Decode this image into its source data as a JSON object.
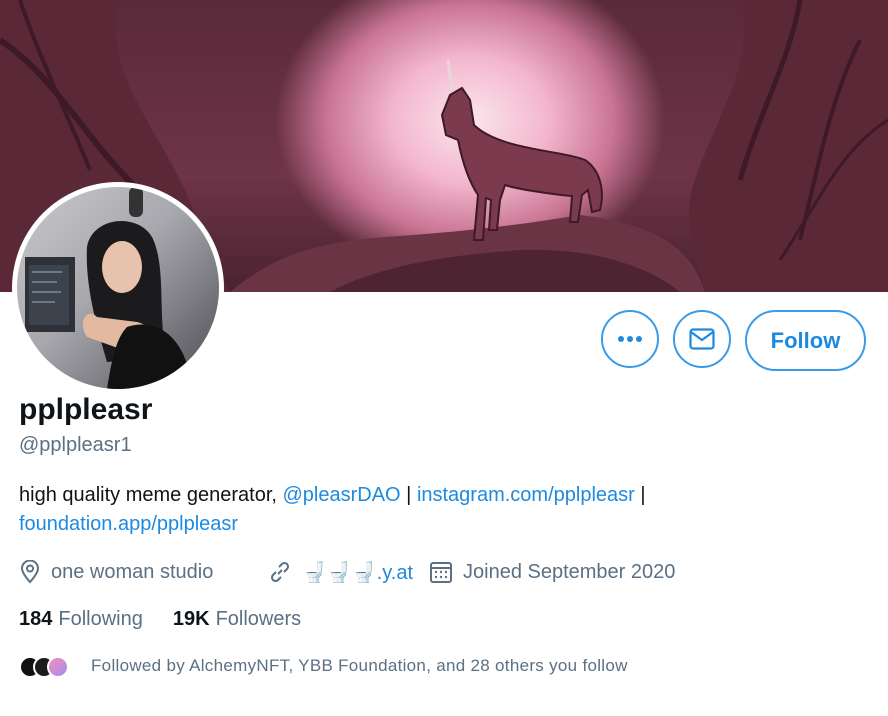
{
  "profile": {
    "name": "pplpleasr",
    "handle": "@pplpleasr1",
    "bio": {
      "text1": "high quality meme generator, ",
      "mention": "@pleasrDAO",
      "sep1": " | ",
      "link1": "instagram.com/pplpleasr",
      "sep2": " |",
      "link2": "foundation.app/pplpleasr"
    },
    "location": "one woman studio",
    "website": "🚽🚽🚽.y.at",
    "joined": "Joined September 2020"
  },
  "actions": {
    "more_icon": "more-icon",
    "message_icon": "mail-icon",
    "follow_label": "Follow"
  },
  "stats": {
    "following_count": "184",
    "following_label": "Following",
    "followers_count": "19K",
    "followers_label": "Followers"
  },
  "followed_by": {
    "text": "Followed by AlchemyNFT, YBB Foundation, and 28 others you follow"
  },
  "colors": {
    "accent": "#1d8ae0",
    "muted": "#5b7083",
    "text": "#0f1419"
  }
}
